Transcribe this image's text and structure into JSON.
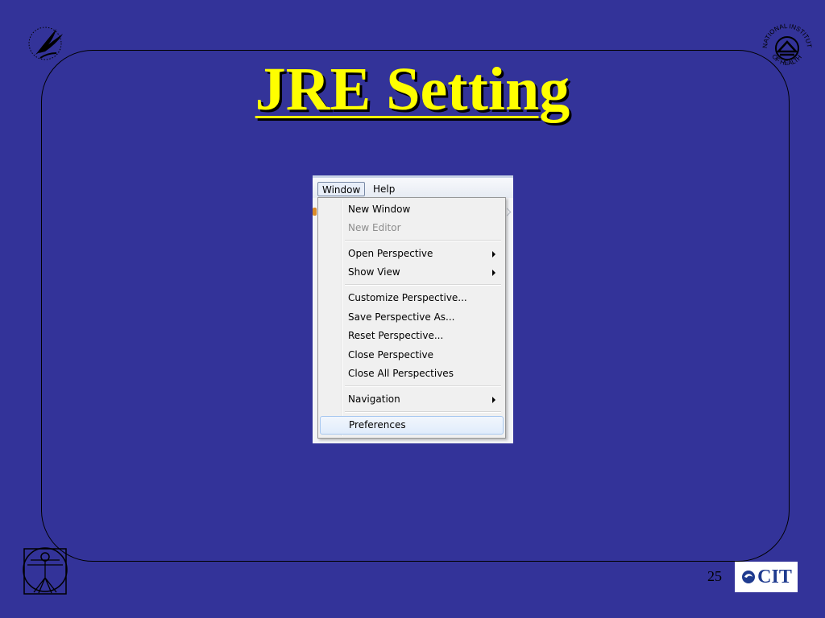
{
  "slide": {
    "title": "JRE Setting",
    "page_number": "25",
    "background_color": "#333399",
    "title_color": "#ffff00"
  },
  "logos": {
    "top_left": "hhs-eagle-logo",
    "top_right": "nih-seal-logo",
    "top_right_text": "NATIONAL INSTITUTES OF HEALTH",
    "bottom_left": "vitruvian-man-logo",
    "bottom_right_text": "CIT"
  },
  "menubar": {
    "items": [
      "Window",
      "Help"
    ]
  },
  "menu": {
    "items": [
      {
        "label": "New Window",
        "disabled": false,
        "submenu": false
      },
      {
        "label": "New Editor",
        "disabled": true,
        "submenu": false
      },
      {
        "label": "Open Perspective",
        "disabled": false,
        "submenu": true
      },
      {
        "label": "Show View",
        "disabled": false,
        "submenu": true
      },
      {
        "label": "Customize Perspective...",
        "disabled": false,
        "submenu": false
      },
      {
        "label": "Save Perspective As...",
        "disabled": false,
        "submenu": false
      },
      {
        "label": "Reset Perspective...",
        "disabled": false,
        "submenu": false
      },
      {
        "label": "Close Perspective",
        "disabled": false,
        "submenu": false
      },
      {
        "label": "Close All Perspectives",
        "disabled": false,
        "submenu": false
      },
      {
        "label": "Navigation",
        "disabled": false,
        "submenu": true
      },
      {
        "label": "Preferences",
        "disabled": false,
        "submenu": false,
        "highlighted": true
      }
    ]
  }
}
